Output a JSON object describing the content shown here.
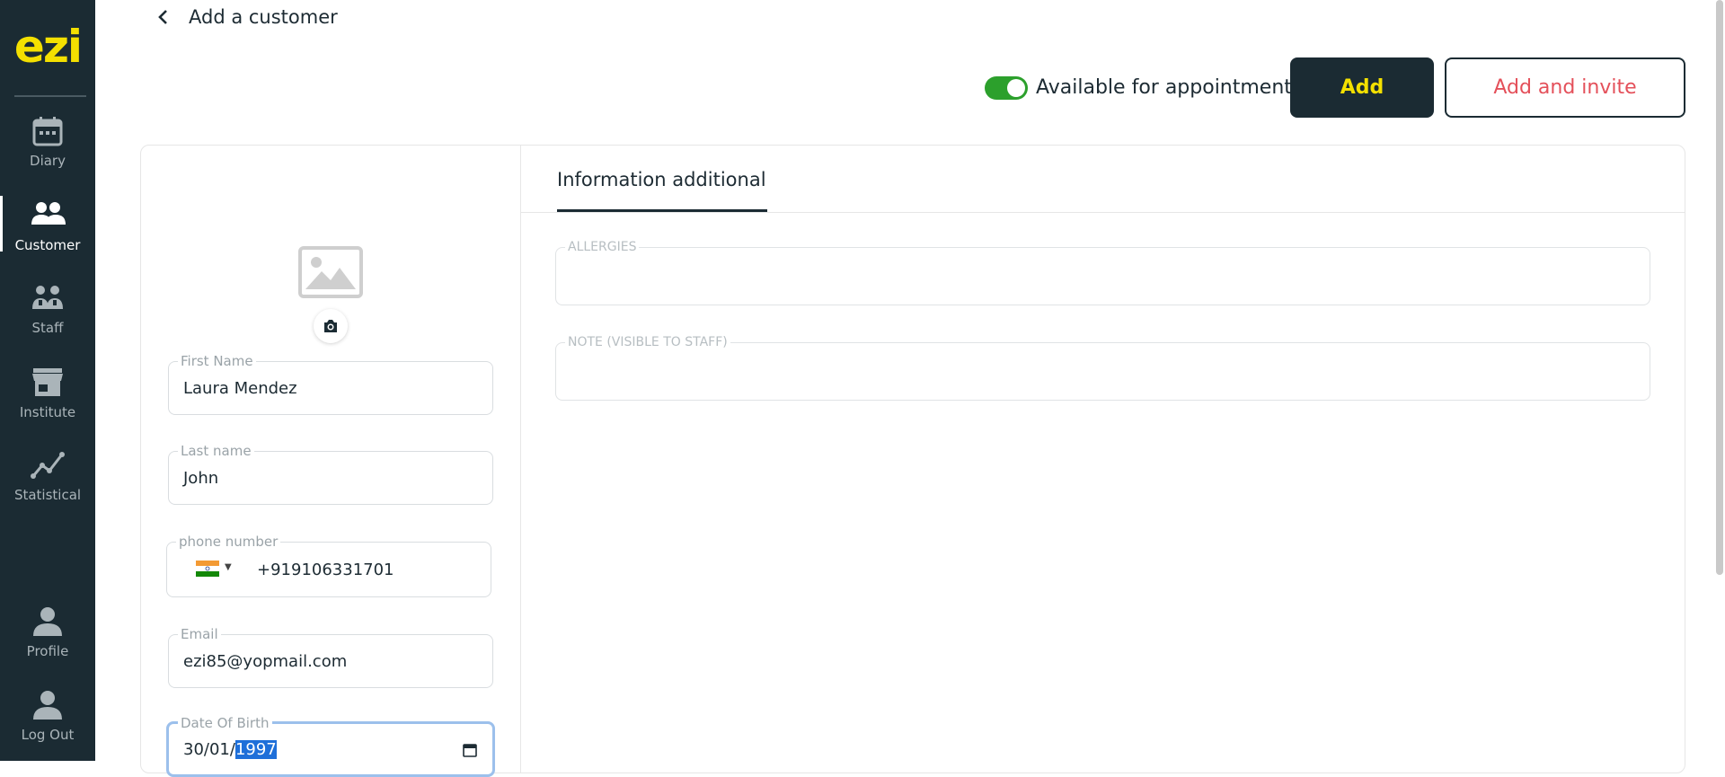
{
  "app": {
    "logo": "ezi"
  },
  "sidebar": {
    "items": [
      {
        "label": "Diary",
        "icon": "calendar-icon"
      },
      {
        "label": "Customer",
        "icon": "users-icon",
        "active": true
      },
      {
        "label": "Staff",
        "icon": "staff-icon"
      },
      {
        "label": "Institute",
        "icon": "store-icon"
      },
      {
        "label": "Statistical",
        "icon": "chart-line-icon"
      }
    ],
    "bottom": [
      {
        "label": "Profile",
        "icon": "user-icon"
      },
      {
        "label": "Log Out",
        "icon": "logout-user-icon"
      }
    ]
  },
  "header": {
    "title": "Add a customer",
    "available_label": "Available for appointment",
    "available_on": true,
    "add_label": "Add",
    "add_invite_label": "Add and invite"
  },
  "form": {
    "first_name": {
      "label": "First Name",
      "value": "Laura Mendez"
    },
    "last_name": {
      "label": "Last name",
      "value": "John"
    },
    "phone": {
      "label": "phone number",
      "value": "+919106331701"
    },
    "email": {
      "label": "Email",
      "value": "ezi85@yopmail.com"
    },
    "dob": {
      "label": "Date Of Birth",
      "value_prefix": "30/01/",
      "value_selected": "1997"
    }
  },
  "additional": {
    "tab_label": "Information additional",
    "allergies_label": "ALLERGIES",
    "note_label": "NOTE (VISIBLE TO STAFF)"
  },
  "colors": {
    "sidebar_bg": "#1b2b33",
    "accent_yellow": "#f4e000",
    "invite_red": "#e4505a",
    "toggle_green": "#2ca02c"
  }
}
